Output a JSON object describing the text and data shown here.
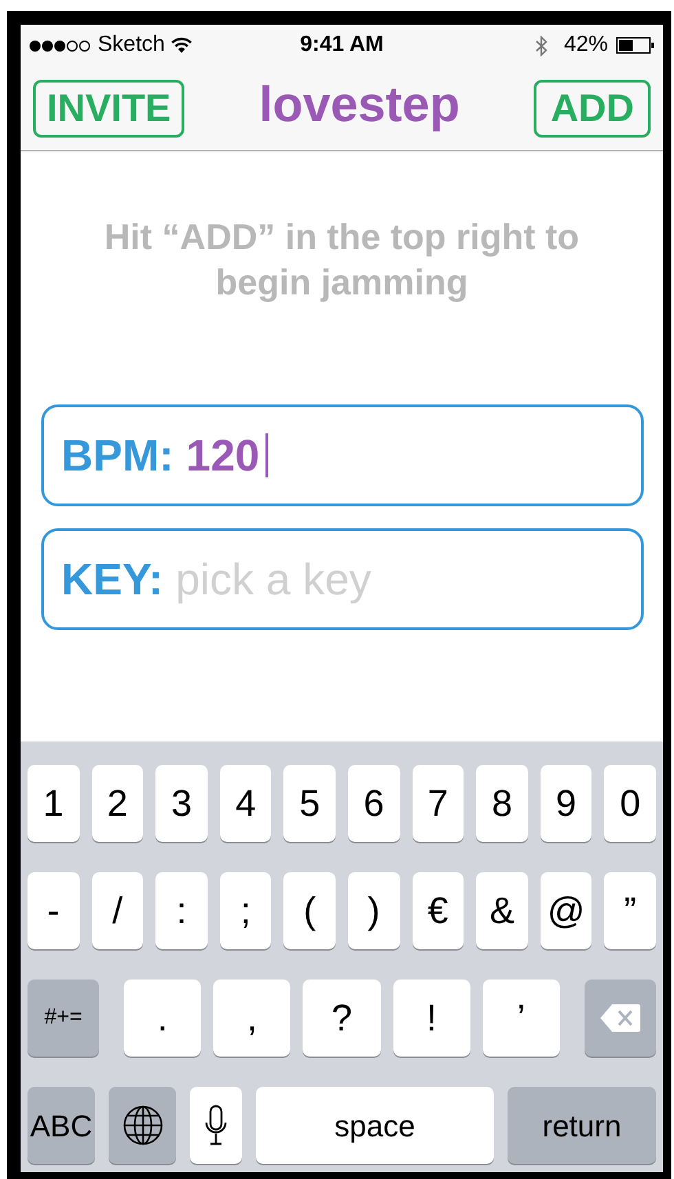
{
  "status_bar": {
    "carrier": "Sketch",
    "time": "9:41 AM",
    "battery": "42%"
  },
  "nav_bar": {
    "left_button": "INVITE",
    "title": "lovestep",
    "right_button": "ADD"
  },
  "hint": "Hit “ADD” in the top right to begin jamming",
  "fields": [
    {
      "label": "BPM:",
      "value": "120",
      "focused": true
    },
    {
      "label": "KEY:",
      "placeholder": "pick a key",
      "focused": false
    }
  ],
  "keyboard": {
    "number_keys": [
      {
        "kind": "char",
        "label": "1"
      },
      {
        "kind": "char",
        "label": "2"
      },
      {
        "kind": "char",
        "label": "3"
      },
      {
        "kind": "char",
        "label": "4"
      },
      {
        "kind": "char",
        "label": "5"
      },
      {
        "kind": "char",
        "label": "6"
      },
      {
        "kind": "char",
        "label": "7"
      },
      {
        "kind": "char",
        "label": "8"
      },
      {
        "kind": "char",
        "label": "9"
      },
      {
        "kind": "char",
        "label": "0"
      }
    ],
    "symbol_keys": [
      {
        "kind": "char",
        "label": "-"
      },
      {
        "kind": "char",
        "label": "/"
      },
      {
        "kind": "char",
        "label": ":"
      },
      {
        "kind": "char",
        "label": ";"
      },
      {
        "kind": "char",
        "label": "("
      },
      {
        "kind": "char",
        "label": ")"
      },
      {
        "kind": "char",
        "label": "€"
      },
      {
        "kind": "char",
        "label": "&"
      },
      {
        "kind": "char",
        "label": "@"
      },
      {
        "kind": "char",
        "label": "”"
      }
    ],
    "punctuation_keys": [
      {
        "kind": "function",
        "label": "#+="
      },
      {
        "kind": "char",
        "label": "."
      },
      {
        "kind": "char",
        "label": ","
      },
      {
        "kind": "char",
        "label": "?"
      },
      {
        "kind": "char",
        "label": "!"
      },
      {
        "kind": "char",
        "label": "’"
      },
      {
        "kind": "delete"
      }
    ],
    "bottom_keys": [
      {
        "kind": "function",
        "label": "ABC"
      },
      {
        "kind": "globe"
      },
      {
        "kind": "mic"
      },
      {
        "kind": "space",
        "label": "space"
      },
      {
        "kind": "function",
        "label": "return"
      }
    ]
  }
}
